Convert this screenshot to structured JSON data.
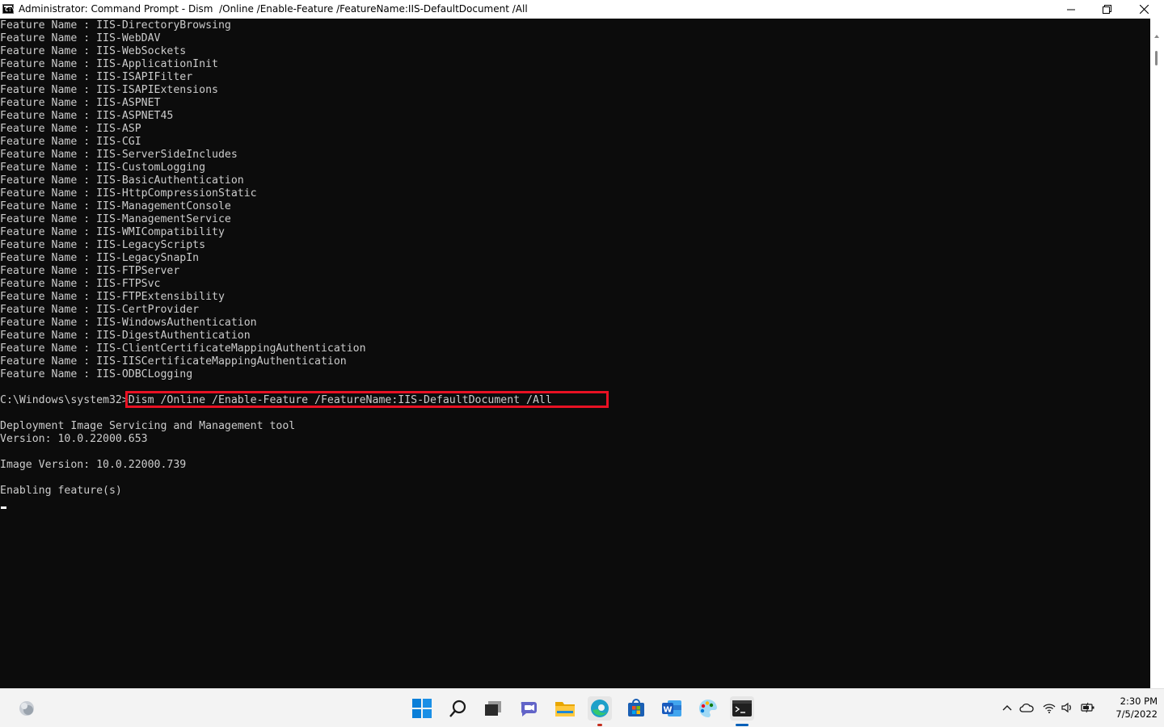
{
  "window": {
    "title": "Administrator: Command Prompt - Dism  /Online /Enable-Feature /FeatureName:IIS-DefaultDocument /All",
    "icon_name": "cmd-app-icon",
    "icon_label": "C:\\",
    "controls": [
      "minimize-icon",
      "maximize-icon",
      "close-icon"
    ]
  },
  "console": {
    "feature_lines": [
      "Feature Name : IIS-DirectoryBrowsing",
      "Feature Name : IIS-WebDAV",
      "Feature Name : IIS-WebSockets",
      "Feature Name : IIS-ApplicationInit",
      "Feature Name : IIS-ISAPIFilter",
      "Feature Name : IIS-ISAPIExtensions",
      "Feature Name : IIS-ASPNET",
      "Feature Name : IIS-ASPNET45",
      "Feature Name : IIS-ASP",
      "Feature Name : IIS-CGI",
      "Feature Name : IIS-ServerSideIncludes",
      "Feature Name : IIS-CustomLogging",
      "Feature Name : IIS-BasicAuthentication",
      "Feature Name : IIS-HttpCompressionStatic",
      "Feature Name : IIS-ManagementConsole",
      "Feature Name : IIS-ManagementService",
      "Feature Name : IIS-WMICompatibility",
      "Feature Name : IIS-LegacyScripts",
      "Feature Name : IIS-LegacySnapIn",
      "Feature Name : IIS-FTPServer",
      "Feature Name : IIS-FTPSvc",
      "Feature Name : IIS-FTPExtensibility",
      "Feature Name : IIS-CertProvider",
      "Feature Name : IIS-WindowsAuthentication",
      "Feature Name : IIS-DigestAuthentication",
      "Feature Name : IIS-ClientCertificateMappingAuthentication",
      "Feature Name : IIS-IISCertificateMappingAuthentication",
      "Feature Name : IIS-ODBCLogging"
    ],
    "prompt": "C:\\Windows\\system32>",
    "command": "Dism /Online /Enable-Feature /FeatureName:IIS-DefaultDocument /All",
    "tool_name": "Deployment Image Servicing and Management tool",
    "tool_version": "Version: 10.0.22000.653",
    "image_version": "Image Version: 10.0.22000.739",
    "status": "Enabling feature(s)"
  },
  "highlight_color": "#e81123",
  "taskbar": {
    "weather_icon": "weather-icon",
    "apps": [
      {
        "name": "start-icon",
        "active": false
      },
      {
        "name": "search-icon",
        "active": false
      },
      {
        "name": "task-view-icon",
        "active": false
      },
      {
        "name": "chat-icon",
        "active": false
      },
      {
        "name": "file-explorer-icon",
        "active": false
      },
      {
        "name": "edge-icon",
        "active": true
      },
      {
        "name": "store-icon",
        "active": false
      },
      {
        "name": "word-icon",
        "active": false
      },
      {
        "name": "paint-icon",
        "active": false
      },
      {
        "name": "terminal-icon",
        "active": true
      }
    ],
    "tray": [
      "chevron-up-icon",
      "onedrive-icon",
      "wifi-icon",
      "volume-icon",
      "battery-icon"
    ],
    "clock": {
      "time": "2:30 PM",
      "date": "7/5/2022"
    }
  }
}
